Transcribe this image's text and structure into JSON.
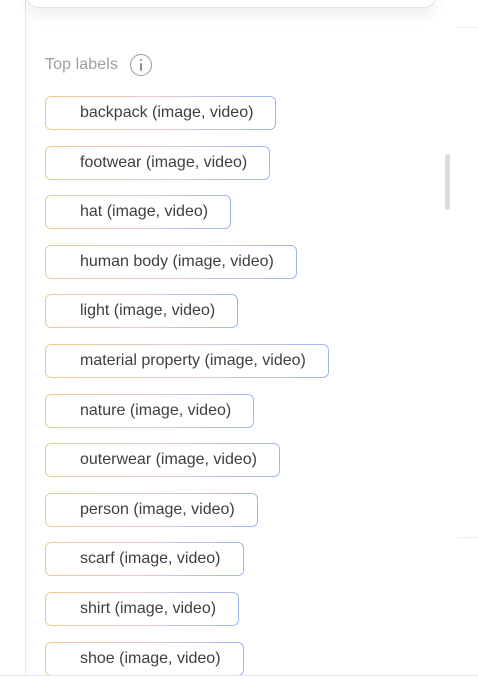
{
  "section": {
    "title": "Top labels",
    "info_icon": "info-icon"
  },
  "labels": [
    "backpack (image, video)",
    "footwear (image, video)",
    "hat (image, video)",
    "human body (image, video)",
    "light (image, video)",
    "material property (image, video)",
    "nature (image, video)",
    "outerwear (image, video)",
    "person (image, video)",
    "scarf (image, video)",
    "shirt (image, video)",
    "shoe (image, video)"
  ],
  "colors": {
    "chip_border_start": "#f3c98e",
    "chip_border_end": "#9fb6ef",
    "chip_text": "#3c4043",
    "header_text": "#a0a0a0"
  }
}
